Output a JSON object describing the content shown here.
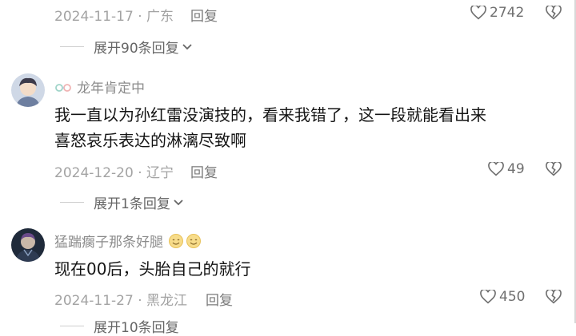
{
  "comments": [
    {
      "date": "2024-11-17",
      "location": "广东",
      "reply_label": "回复",
      "likes": "2742",
      "expand_text": "展开90条回复"
    },
    {
      "username": "龙年肯定中",
      "content_line1": "我一直以为孙红雷没演技的，看来我错了，这一段就能看出来",
      "content_line2": "喜怒哀乐表达的淋漓尽致啊",
      "date": "2024-12-20",
      "location": "辽宁",
      "reply_label": "回复",
      "likes": "49",
      "expand_text": "展开1条回复"
    },
    {
      "username": "猛踹瘸子那条好腿",
      "content_line1": "现在00后，头胎自己的就行",
      "date": "2024-11-27",
      "location": "黑龙江",
      "reply_label": "回复",
      "likes": "450",
      "expand_text": "展开10条回复"
    }
  ],
  "separator": " · ",
  "icons": {
    "like": "heart-outline-icon",
    "dislike": "broken-heart-icon",
    "chevron": "chevron-down-icon",
    "badge": "glasses-badge-icon",
    "emoji": "sweat-smile-emoji-icon"
  },
  "colors": {
    "text": "#141414",
    "meta": "#a3a3a3",
    "username": "#8b8b8b",
    "background": "#ffffff"
  }
}
